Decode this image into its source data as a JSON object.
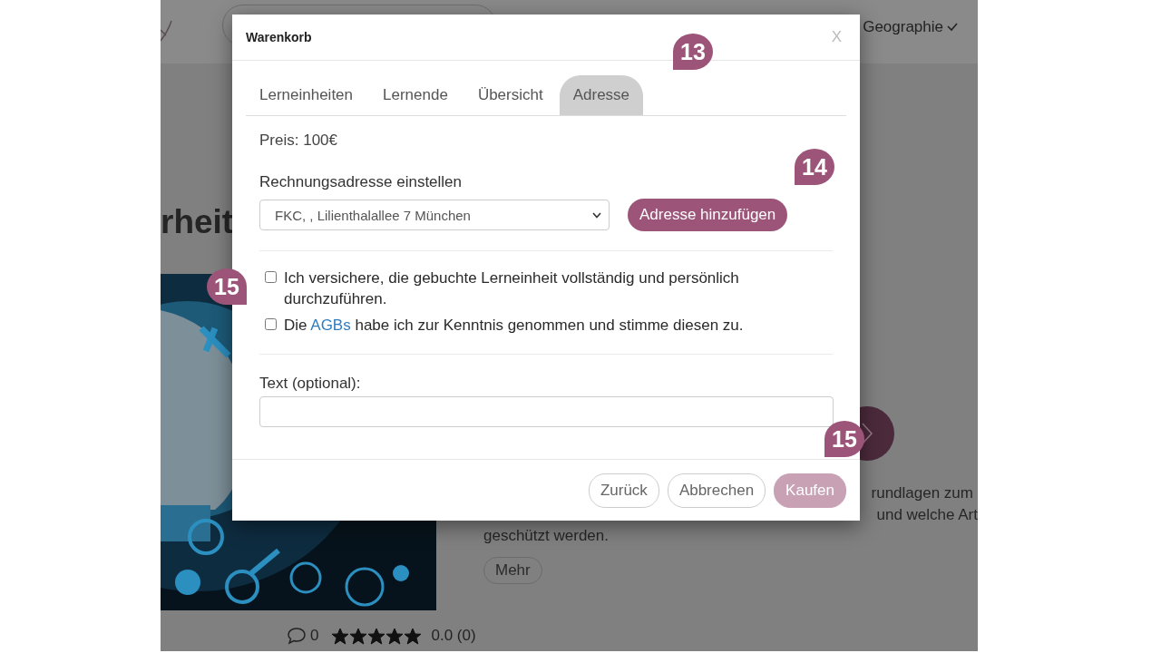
{
  "header": {
    "nav_item": "Geographie"
  },
  "background": {
    "heading_fragment": "rheit",
    "description_lines": [
      "rundlagen zum",
      "und welche Art",
      "geschützt werden."
    ],
    "more_button": "Mehr",
    "comments": "0",
    "rating": {
      "stars": 5,
      "score": "0.0 (0)"
    }
  },
  "modal": {
    "title": "Warenkorb",
    "close": "X",
    "tabs": [
      {
        "label": "Lerneinheiten",
        "selected": false
      },
      {
        "label": "Lernende",
        "selected": false
      },
      {
        "label": "Übersicht",
        "selected": false
      },
      {
        "label": "Adresse",
        "selected": true
      }
    ],
    "price": "Preis: 100€",
    "address_label": "Rechnungsadresse einstellen",
    "address_value": "FKC, , Lilienthalallee 7 München",
    "add_address_button": "Adresse hinzufügen",
    "checkboxes": [
      {
        "kind": "plain",
        "text": "Ich versichere, die gebuchte Lerneinheit vollständig und persönlich durchzuführen.",
        "checked": false
      },
      {
        "kind": "link",
        "before": "Die ",
        "link": "AGBs",
        "after": " habe ich zur Kenntnis genommen und stimme diesen zu.",
        "checked": false
      }
    ],
    "text_label": "Text (optional):",
    "buttons": [
      {
        "label": "Zurück",
        "kind": "outline",
        "disabled": false
      },
      {
        "label": "Abbrechen",
        "kind": "outline",
        "disabled": false
      },
      {
        "label": "Kaufen",
        "kind": "primary",
        "disabled": true
      }
    ]
  },
  "annotations": [
    {
      "number": "13",
      "kind": "tail_left"
    },
    {
      "number": "14",
      "kind": "tail_left"
    },
    {
      "number": "15",
      "kind": "tail_right"
    },
    {
      "number": "15",
      "kind": "tail_left"
    }
  ]
}
